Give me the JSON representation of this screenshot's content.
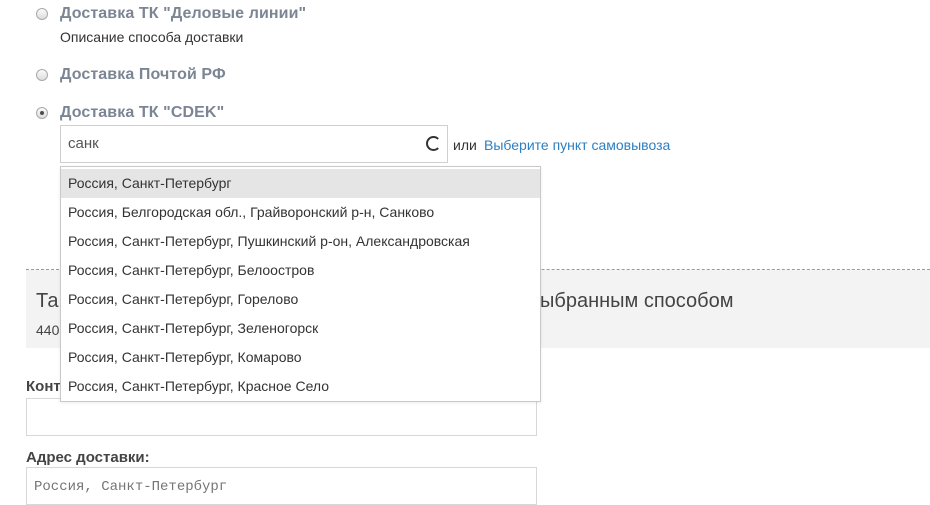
{
  "delivery": {
    "options": [
      {
        "label": "Доставка ТК \"Деловые линии\"",
        "checked": false
      },
      {
        "label": "Доставка Почтой РФ",
        "checked": false
      },
      {
        "label": "Доставка ТК \"CDEK\"",
        "checked": true
      }
    ],
    "option_description": "Описание способа доставки"
  },
  "city": {
    "value": "санк",
    "or_text": "или",
    "pickup_link": "Выберите пункт самовывоза"
  },
  "suggestions": [
    "Россия, Санкт-Петербург",
    "Россия, Белгородская обл., Грайворонский р-н, Санково",
    "Россия, Санкт-Петербург, Пушкинский р-он, Александровская",
    "Россия, Санкт-Петербург, Белоостров",
    "Россия, Санкт-Петербург, Горелово",
    "Россия, Санкт-Петербург, Зеленогорск",
    "Россия, Санкт-Петербург, Комарово",
    "Россия, Санкт-Петербург, Красное Село"
  ],
  "info": {
    "title_left": "Та",
    "title_right": "ыбранным способом",
    "sub": "440"
  },
  "form": {
    "contact_label": "Конт",
    "contact_value": "",
    "address_label": "Адрес доставки:",
    "address_placeholder": "Россия, Санкт-Петербург"
  },
  "colors": {
    "link": "#2d7fc1",
    "option_label": "#7b8593",
    "highlight": "#e5e5e5"
  }
}
